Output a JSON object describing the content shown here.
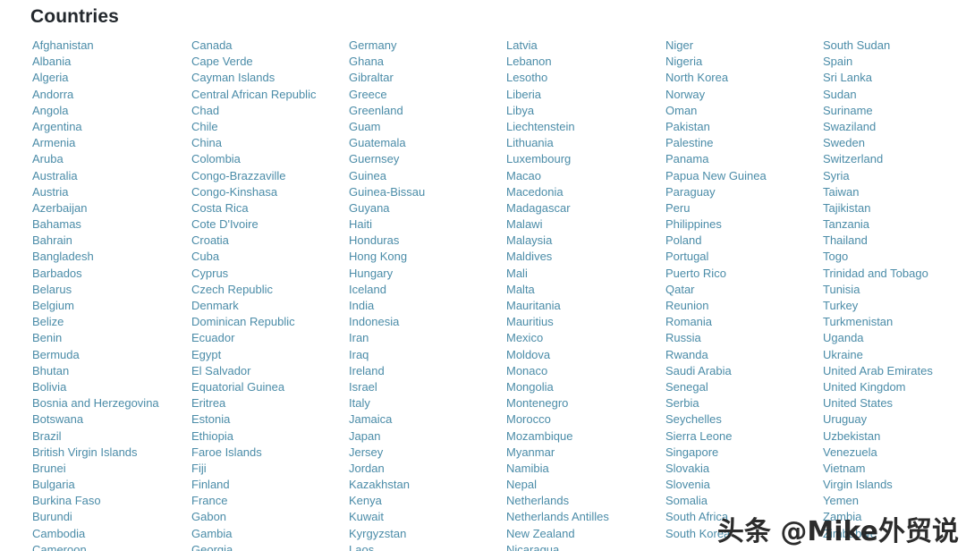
{
  "page": {
    "title": "Countries",
    "background_color": "#ffffff",
    "title_color": "#23282d",
    "link_color": "#4b8ca8"
  },
  "watermark": {
    "text": "头条 @Mike外贸说"
  },
  "columns": [
    {
      "index": 1,
      "items": [
        "Afghanistan",
        "Albania",
        "Algeria",
        "Andorra",
        "Angola",
        "Argentina",
        "Armenia",
        "Aruba",
        "Australia",
        "Austria",
        "Azerbaijan",
        "Bahamas",
        "Bahrain",
        "Bangladesh",
        "Barbados",
        "Belarus",
        "Belgium",
        "Belize",
        "Benin",
        "Bermuda",
        "Bhutan",
        "Bolivia",
        "Bosnia and Herzegovina",
        "Botswana",
        "Brazil",
        "British Virgin Islands",
        "Brunei",
        "Bulgaria",
        "Burkina Faso",
        "Burundi",
        "Cambodia",
        "Cameroon"
      ]
    },
    {
      "index": 2,
      "items": [
        "Canada",
        "Cape Verde",
        "Cayman Islands",
        "Central African Republic",
        "Chad",
        "Chile",
        "China",
        "Colombia",
        "Congo-Brazzaville",
        "Congo-Kinshasa",
        "Costa Rica",
        "Cote D'Ivoire",
        "Croatia",
        "Cuba",
        "Cyprus",
        "Czech Republic",
        "Denmark",
        "Dominican Republic",
        "Ecuador",
        "Egypt",
        "El Salvador",
        "Equatorial Guinea",
        "Eritrea",
        "Estonia",
        "Ethiopia",
        "Faroe Islands",
        "Fiji",
        "Finland",
        "France",
        "Gabon",
        "Gambia",
        "Georgia"
      ]
    },
    {
      "index": 3,
      "items": [
        "Germany",
        "Ghana",
        "Gibraltar",
        "Greece",
        "Greenland",
        "Guam",
        "Guatemala",
        "Guernsey",
        "Guinea",
        "Guinea-Bissau",
        "Guyana",
        "Haiti",
        "Honduras",
        "Hong Kong",
        "Hungary",
        "Iceland",
        "India",
        "Indonesia",
        "Iran",
        "Iraq",
        "Ireland",
        "Israel",
        "Italy",
        "Jamaica",
        "Japan",
        "Jersey",
        "Jordan",
        "Kazakhstan",
        "Kenya",
        "Kuwait",
        "Kyrgyzstan",
        "Laos"
      ]
    },
    {
      "index": 4,
      "items": [
        "Latvia",
        "Lebanon",
        "Lesotho",
        "Liberia",
        "Libya",
        "Liechtenstein",
        "Lithuania",
        "Luxembourg",
        "Macao",
        "Macedonia",
        "Madagascar",
        "Malawi",
        "Malaysia",
        "Maldives",
        "Mali",
        "Malta",
        "Mauritania",
        "Mauritius",
        "Mexico",
        "Moldova",
        "Monaco",
        "Mongolia",
        "Montenegro",
        "Morocco",
        "Mozambique",
        "Myanmar",
        "Namibia",
        "Nepal",
        "Netherlands",
        "Netherlands Antilles",
        "New Zealand",
        "Nicaragua"
      ]
    },
    {
      "index": 5,
      "items": [
        "Niger",
        "Nigeria",
        "North Korea",
        "Norway",
        "Oman",
        "Pakistan",
        "Palestine",
        "Panama",
        "Papua New Guinea",
        "Paraguay",
        "Peru",
        "Philippines",
        "Poland",
        "Portugal",
        "Puerto Rico",
        "Qatar",
        "Reunion",
        "Romania",
        "Russia",
        "Rwanda",
        "Saudi Arabia",
        "Senegal",
        "Serbia",
        "Seychelles",
        "Sierra Leone",
        "Singapore",
        "Slovakia",
        "Slovenia",
        "Somalia",
        "South Africa",
        "South Korea"
      ]
    },
    {
      "index": 6,
      "items": [
        "South Sudan",
        "Spain",
        "Sri Lanka",
        "Sudan",
        "Suriname",
        "Swaziland",
        "Sweden",
        "Switzerland",
        "Syria",
        "Taiwan",
        "Tajikistan",
        "Tanzania",
        "Thailand",
        "Togo",
        "Trinidad and Tobago",
        "Tunisia",
        "Turkey",
        "Turkmenistan",
        "Uganda",
        "Ukraine",
        "United Arab Emirates",
        "United Kingdom",
        "United States",
        "Uruguay",
        "Uzbekistan",
        "Venezuela",
        "Vietnam",
        "Virgin Islands",
        "Yemen",
        "Zambia",
        "Zimbabwe"
      ]
    }
  ]
}
